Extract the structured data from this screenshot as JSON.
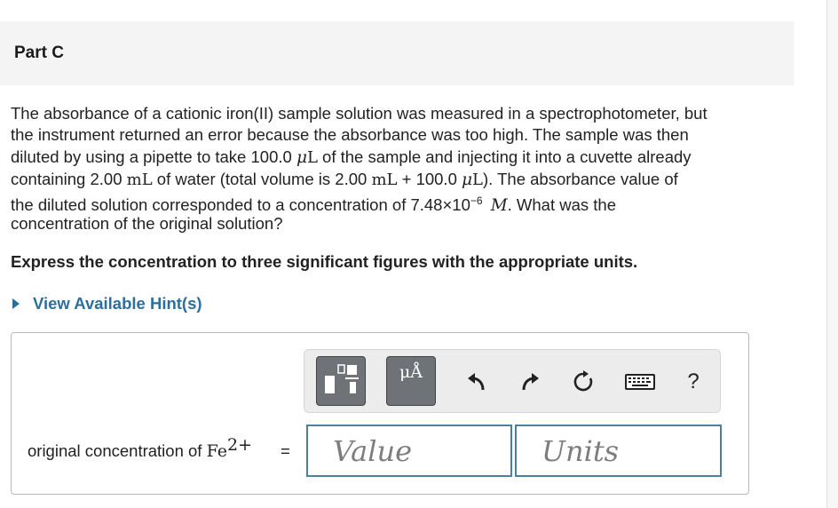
{
  "part": {
    "title": "Part C"
  },
  "question": {
    "line1": "The absorbance of a cationic iron(II) sample solution was measured in a spectrophotometer, but",
    "line2": "the instrument returned an error because the absorbance was too high. The sample was then",
    "line3_a": "diluted by using a pipette to take 100.0 ",
    "mu": "μ",
    "L": "L",
    "line3_b": " of the sample and injecting it into a cuvette already",
    "line4_a": "containing 2.00 ",
    "mL": "mL",
    "line4_b": " of water (total volume is 2.00 ",
    "line4_c": " + 100.0 ",
    "line4_d": "). The absorbance value of",
    "line5_a": "the diluted solution corresponded to a concentration of 7.48×10",
    "exponent": "−6",
    "M": "M",
    "line5_b": ". What was the",
    "line6": "concentration of the original solution?"
  },
  "instruction": "Express the concentration to three significant figures with the appropriate units.",
  "hint": {
    "label": "View Available Hint(s)"
  },
  "toolbar": {
    "templates_icon": "templates-icon",
    "units_label": "μÅ",
    "undo_icon": "undo-icon",
    "redo_icon": "redo-icon",
    "reset_icon": "reset-icon",
    "keyboard_icon": "keyboard-icon",
    "help_label": "?"
  },
  "answer": {
    "label_text": "original concentration of ",
    "species": "Fe",
    "charge": "2+",
    "equals": "=",
    "value_placeholder": "Value",
    "units_placeholder": "Units"
  },
  "colors": {
    "link": "#2d6f9c",
    "field_border": "#4a7fa8",
    "header_bg": "#f4f4f4"
  }
}
